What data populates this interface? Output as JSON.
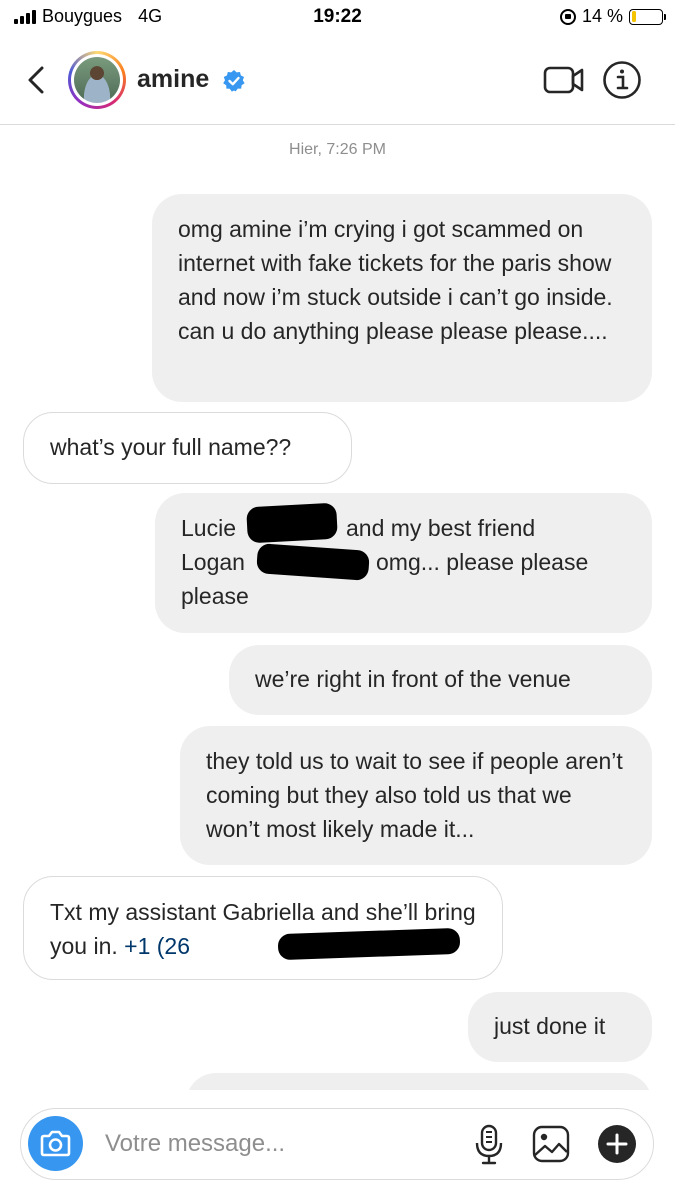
{
  "status_bar": {
    "carrier": "Bouygues",
    "network": "4G",
    "time": "19:22",
    "battery_percent": "14 %",
    "battery_level": 0.14,
    "icons": [
      "signal-icon",
      "orientation-lock-icon",
      "battery-icon"
    ]
  },
  "header": {
    "username": "amine",
    "verified": true,
    "icons": [
      "back-icon",
      "avatar",
      "verified-icon",
      "video-call-icon",
      "info-icon"
    ],
    "colors": {
      "verified": "#3897f0"
    }
  },
  "conversation": {
    "timestamp": "Hier, 7:26 PM",
    "messages": [
      {
        "from": "me",
        "text": "omg amine i’m crying i got scammed on internet with fake tickets for the paris show and now i’m stuck outside i can’t go inside. can u do anything please please please...."
      },
      {
        "from": "them",
        "text": "what’s your full name??"
      },
      {
        "from": "me",
        "parts": [
          "Lucie",
          "and my best friend",
          "Logan",
          "omg... please please",
          "please"
        ],
        "redacted": true
      },
      {
        "from": "me",
        "text": "we’re right in front of the venue"
      },
      {
        "from": "me",
        "text": "they told us to wait to see if people aren’t coming but they also told us that we won’t most likely made it..."
      },
      {
        "from": "them",
        "text": "Txt my assistant Gabriella and she’ll bring you in.",
        "phone": "+1 (26",
        "redacted": true
      },
      {
        "from": "me",
        "text": "just done it"
      }
    ]
  },
  "composer": {
    "placeholder": "Votre message...",
    "value": "",
    "icons": [
      "camera-icon",
      "microphone-icon",
      "gallery-icon",
      "plus-icon"
    ],
    "colors": {
      "camera_button": "#3797f0"
    }
  }
}
